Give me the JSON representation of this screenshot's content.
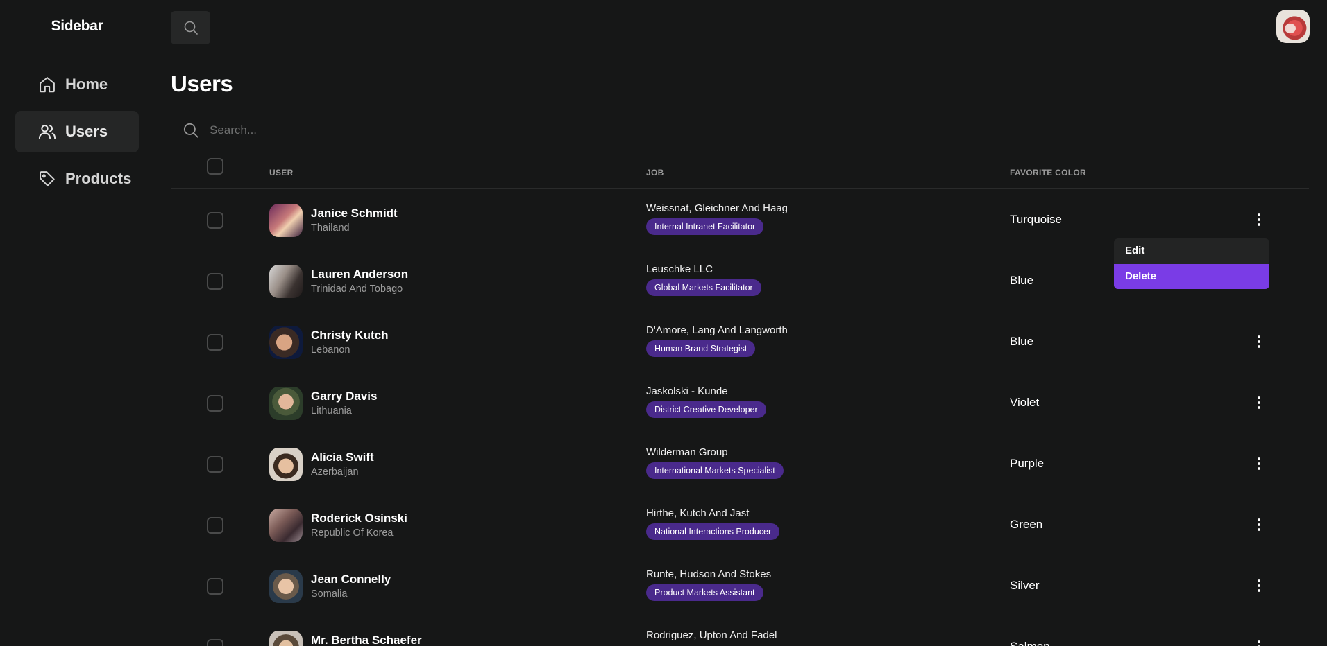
{
  "sidebar": {
    "brand": "Sidebar",
    "items": [
      {
        "label": "Home",
        "icon": "home-icon",
        "active": false
      },
      {
        "label": "Users",
        "icon": "users-icon",
        "active": true
      },
      {
        "label": "Products",
        "icon": "tag-icon",
        "active": false
      }
    ]
  },
  "header": {
    "search_icon": "search-icon",
    "avatar": "user-avatar"
  },
  "main": {
    "title": "Users",
    "search_placeholder": "Search...",
    "columns": {
      "user": "USER",
      "job": "JOB",
      "favorite_color": "FAVORITE COLOR"
    },
    "rows": [
      {
        "name": "Janice Schmidt",
        "country": "Thailand",
        "company": "Weissnat, Gleichner And Haag",
        "title": "Internal Intranet Facilitator",
        "color": "Turquoise"
      },
      {
        "name": "Lauren Anderson",
        "country": "Trinidad And Tobago",
        "company": "Leuschke LLC",
        "title": "Global Markets Facilitator",
        "color": "Blue"
      },
      {
        "name": "Christy Kutch",
        "country": "Lebanon",
        "company": "D'Amore, Lang And Langworth",
        "title": "Human Brand Strategist",
        "color": "Blue"
      },
      {
        "name": "Garry Davis",
        "country": "Lithuania",
        "company": "Jaskolski - Kunde",
        "title": "District Creative Developer",
        "color": "Violet"
      },
      {
        "name": "Alicia Swift",
        "country": "Azerbaijan",
        "company": "Wilderman Group",
        "title": "International Markets Specialist",
        "color": "Purple"
      },
      {
        "name": "Roderick Osinski",
        "country": "Republic Of Korea",
        "company": "Hirthe, Kutch And Jast",
        "title": "National Interactions Producer",
        "color": "Green"
      },
      {
        "name": "Jean Connelly",
        "country": "Somalia",
        "company": "Runte, Hudson And Stokes",
        "title": "Product Markets Assistant",
        "color": "Silver"
      },
      {
        "name": "Mr. Bertha Schaefer",
        "country": "",
        "company": "Rodriguez, Upton And Fadel",
        "title": "",
        "color": "Salmon"
      }
    ],
    "row_menu": {
      "edit": "Edit",
      "delete": "Delete"
    }
  },
  "colors": {
    "background": "#161717",
    "accent": "#7a3ce6",
    "badge": "#4a2a8c",
    "active_nav": "#252626"
  }
}
